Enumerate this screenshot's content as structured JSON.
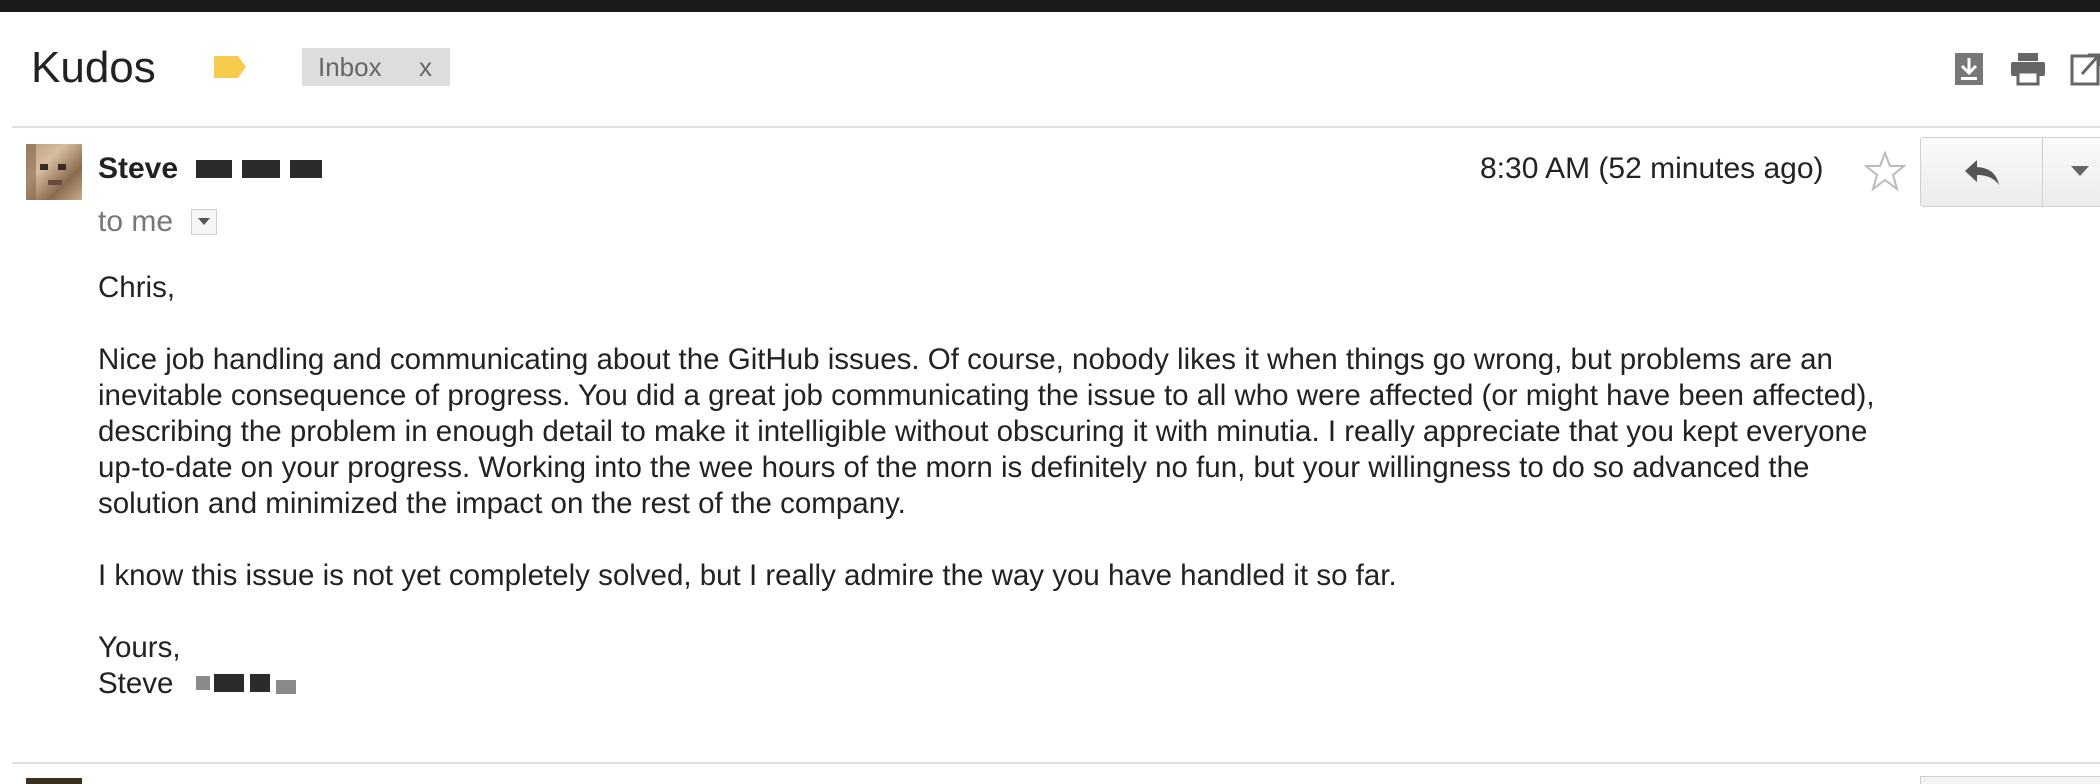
{
  "thread": {
    "subject": "Kudos",
    "label_icon": "label-tag-icon",
    "label_color": "#f7cb4d",
    "inbox_chip": {
      "label": "Inbox",
      "remove": "x"
    },
    "toolbar_icons": [
      "download-icon",
      "print-icon",
      "new-window-icon"
    ]
  },
  "message": {
    "sender_name": "Steve",
    "recipient_text": "to me",
    "timestamp": "8:30 AM (52 minutes ago)",
    "star_icon": "star-outline-icon",
    "reply_icon": "reply-arrow-icon",
    "more_icon": "chevron-down-icon",
    "body": {
      "greeting": "Chris,",
      "paragraph1_line1": "Nice job handling and communicating about the GitHub issues.  Of course, nobody likes it when things go wrong, but problems are an",
      "paragraph1_line2": "inevitable consequence of progress.  You did a great job communicating the issue to all who were affected (or might have been affected),",
      "paragraph1_line3": "describing the problem in enough detail to make it intelligible without obscuring it with minutia.  I really appreciate that you kept everyone",
      "paragraph1_line4": "up-to-date on your progress.  Working into the wee hours of the morn is definitely no fun, but your willingness to do so advanced the",
      "paragraph1_line5": "solution and minimized the impact on the rest of the company.",
      "paragraph2": "I know this issue is not yet completely solved, but I really admire the way you have handled it so far.",
      "closing": "Yours,",
      "signature": "Steve"
    }
  },
  "colors": {
    "chip_bg": "#dddddd",
    "muted_text": "#777777",
    "divider": "#e0e0e0"
  }
}
